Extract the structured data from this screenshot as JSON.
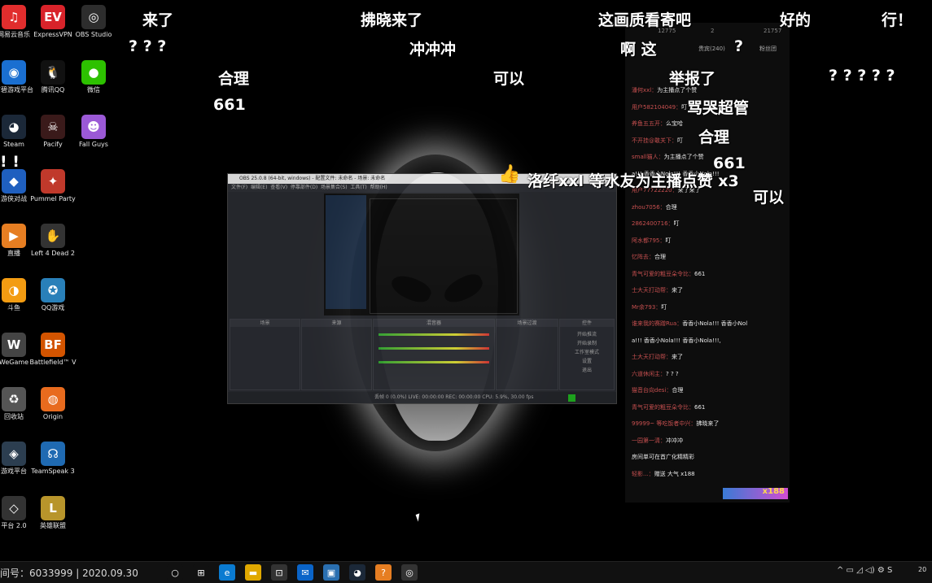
{
  "desktop_icons": [
    {
      "name": "netease-music-icon",
      "label": "网易云音乐",
      "color": "#e12d2d",
      "glyph": "♫"
    },
    {
      "name": "expressvpn-icon",
      "label": "ExpressVPN",
      "color": "#d8232a",
      "glyph": "EV"
    },
    {
      "name": "obs-studio-icon",
      "label": "OBS Studio",
      "color": "#2d2d2d",
      "glyph": "◎"
    },
    {
      "name": "uplay-icon",
      "label": "育碧游戏平台",
      "color": "#1a6fd1",
      "glyph": "◉"
    },
    {
      "name": "qq-icon",
      "label": "腾讯QQ",
      "color": "#111",
      "glyph": "🐧"
    },
    {
      "name": "wechat-icon",
      "label": "微信",
      "color": "#2dc100",
      "glyph": "●"
    },
    {
      "name": "steam-icon",
      "label": "Steam",
      "color": "#1b2838",
      "glyph": "◕"
    },
    {
      "name": "pacify-icon",
      "label": "Pacify",
      "color": "#3a1a1a",
      "glyph": "☠"
    },
    {
      "name": "fall-guys-icon",
      "label": "Fall Guys",
      "color": "#9b59d6",
      "glyph": "☻"
    },
    {
      "name": "app-icon",
      "label": "游侠对战",
      "color": "#1f5fbf",
      "glyph": "◆"
    },
    {
      "name": "pummel-party-icon",
      "label": "Pummel Party",
      "color": "#c0392b",
      "glyph": "✦"
    },
    {
      "name": "launcher-icon",
      "label": "直播",
      "color": "#e67e22",
      "glyph": "▶"
    },
    {
      "name": "left4dead-icon",
      "label": "Left 4 Dead 2",
      "color": "#333",
      "glyph": "✋"
    },
    {
      "name": "douyu-icon",
      "label": "斗鱼",
      "color": "#f39c12",
      "glyph": "◑"
    },
    {
      "name": "qq-games-icon",
      "label": "QQ游戏",
      "color": "#2980b9",
      "glyph": "✪"
    },
    {
      "name": "wegame-icon",
      "label": "WeGame",
      "color": "#444",
      "glyph": "W"
    },
    {
      "name": "battlefield-icon",
      "label": "Battlefield™ V",
      "color": "#d35400",
      "glyph": "BF"
    },
    {
      "name": "recycle-bin-icon",
      "label": "回收站",
      "color": "#555",
      "glyph": "♻"
    },
    {
      "name": "origin-icon",
      "label": "Origin",
      "color": "#e86b1e",
      "glyph": "◍"
    },
    {
      "name": "game-icon",
      "label": "游戏平台",
      "color": "#2c3e50",
      "glyph": "◈"
    },
    {
      "name": "teamspeak-icon",
      "label": "TeamSpeak 3",
      "color": "#1f6ab2",
      "glyph": "☊"
    },
    {
      "name": "wg-platform-icon",
      "label": "平台 2.0",
      "color": "#333",
      "glyph": "◇"
    },
    {
      "name": "lol-icon",
      "label": "英雄联盟",
      "color": "#b8952b",
      "glyph": "L"
    }
  ],
  "danmaku": [
    {
      "text": "来了"
    },
    {
      "text": "拂晓来了"
    },
    {
      "text": "这画质看寄吧"
    },
    {
      "text": "好的"
    },
    {
      "text": "行！"
    },
    {
      "text": "? ? ?"
    },
    {
      "text": "冲冲冲"
    },
    {
      "text": "啊 这"
    },
    {
      "text": "?"
    },
    {
      "text": "合理"
    },
    {
      "text": "可以"
    },
    {
      "text": "举报了"
    },
    {
      "text": "? ? ? ? ?"
    },
    {
      "text": "661"
    },
    {
      "text": "骂哭超管"
    },
    {
      "text": "合理"
    },
    {
      "text": "! !"
    },
    {
      "text": "661"
    },
    {
      "text": "洛纤xxl 等水友为主播点赞 x3"
    },
    {
      "text": "可以"
    }
  ],
  "obs": {
    "title": "OBS 25.0.8 (64-bit, windows) - 配置文件: 未命名 - 场景: 未命名",
    "menu": [
      "文件(F)",
      "编辑(E)",
      "查看(V)",
      "停靠部件(D)",
      "场景集合(S)",
      "工具(T)",
      "帮助(H)"
    ],
    "docks": [
      "场景",
      "来源",
      "混音器",
      "场景过渡",
      "控件"
    ],
    "controls": [
      "开始推流",
      "开始录制",
      "工作室模式",
      "设置",
      "退出"
    ],
    "status": "丢帧 0 (0.0%)    LIVE: 00:00:00    REC: 00:00:00    CPU: 5.9%, 30.00 fps"
  },
  "chat": {
    "top_counts": [
      "12775",
      "2",
      "21757"
    ],
    "tabs": [
      "贵宾(240)",
      "粉丝团"
    ],
    "rows": [
      {
        "u": "潘何xxl：",
        "m": "为主播点了个赞"
      },
      {
        "u": "用户582104049：",
        "m": "叮"
      },
      {
        "u": "养鱼五五开：",
        "m": "么宝哈"
      },
      {
        "u": "不开挂@敢关下：",
        "m": "叮"
      },
      {
        "u": "small猫人：",
        "m": "为主播点了个赞"
      },
      {
        "u": "",
        "m": "a!!! 香香小Nola!!! 香香小Nola!!!"
      },
      {
        "u": "用户77722220：",
        "m": "来了来了"
      },
      {
        "u": "zhou7056：",
        "m": "合理"
      },
      {
        "u": "2862400716：",
        "m": "叮"
      },
      {
        "u": "阿水都795：",
        "m": "叮"
      },
      {
        "u": "忆阵去：",
        "m": "合理"
      },
      {
        "u": "青气可爱的粗豆朵令比：",
        "m": "661"
      },
      {
        "u": "士大天打动帮：",
        "m": "来了"
      },
      {
        "u": "Mr余793：",
        "m": "叮"
      },
      {
        "u": "谁来我的赛蹭Rua：",
        "m": "香香小Nola!!! 香香小Nol"
      },
      {
        "u": "",
        "m": "a!!! 香香小Nola!!! 香香小Nola!!!,"
      },
      {
        "u": "土大天打动帮：",
        "m": "来了"
      },
      {
        "u": "六道休闲主：",
        "m": "? ? ?"
      },
      {
        "u": "猫音台向desi：",
        "m": "合理"
      },
      {
        "u": "青气可爱的粗豆朵令比：",
        "m": "661"
      },
      {
        "u": "99999~ 等吃饭者中兴：",
        "m": "拂晓来了"
      },
      {
        "u": "一园第一清：",
        "m": "冲冲冲"
      },
      {
        "u": "",
        "m": "房间单可在首广化精精彩"
      },
      {
        "u": "轻影...：",
        "m": "赠送 大气 x188"
      }
    ],
    "gift_badge": "x188"
  },
  "watermark": "间号：6033999 | 2020.09.30",
  "taskbar": {
    "items": [
      {
        "name": "search-icon",
        "glyph": "○",
        "color": "#111"
      },
      {
        "name": "task-view-icon",
        "glyph": "⊞",
        "color": "#111"
      },
      {
        "name": "edge-icon",
        "glyph": "e",
        "color": "#0a7bd1"
      },
      {
        "name": "file-explorer-icon",
        "glyph": "▬",
        "color": "#e0a800"
      },
      {
        "name": "store-icon",
        "glyph": "⊡",
        "color": "#333"
      },
      {
        "name": "mail-icon",
        "glyph": "✉",
        "color": "#0a64c8"
      },
      {
        "name": "photos-icon",
        "glyph": "▣",
        "color": "#2a6fb0"
      },
      {
        "name": "steam-taskbar-icon",
        "glyph": "◕",
        "color": "#1b2838"
      },
      {
        "name": "app-taskbar-icon",
        "glyph": "?",
        "color": "#e67e22"
      },
      {
        "name": "obs-taskbar-icon",
        "glyph": "◎",
        "color": "#333"
      }
    ],
    "tray": "^ ▭ ◿ ◁) ⚙ S",
    "clock": "20"
  }
}
